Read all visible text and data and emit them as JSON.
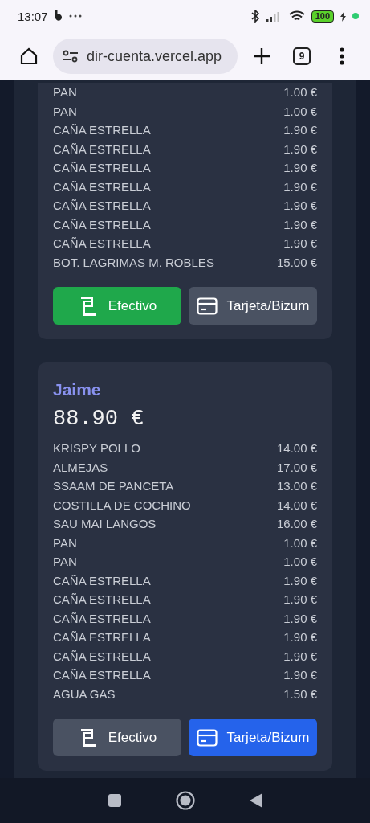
{
  "status_bar": {
    "time": "13:07",
    "battery": "100"
  },
  "browser": {
    "url": "dir-cuenta.vercel.app",
    "tab_count": "9"
  },
  "people": [
    {
      "items": [
        {
          "name": "PAN",
          "price": "1.00 €"
        },
        {
          "name": "PAN",
          "price": "1.00 €"
        },
        {
          "name": "CAÑA ESTRELLA",
          "price": "1.90 €"
        },
        {
          "name": "CAÑA ESTRELLA",
          "price": "1.90 €"
        },
        {
          "name": "CAÑA ESTRELLA",
          "price": "1.90 €"
        },
        {
          "name": "CAÑA ESTRELLA",
          "price": "1.90 €"
        },
        {
          "name": "CAÑA ESTRELLA",
          "price": "1.90 €"
        },
        {
          "name": "CAÑA ESTRELLA",
          "price": "1.90 €"
        },
        {
          "name": "CAÑA ESTRELLA",
          "price": "1.90 €"
        },
        {
          "name": "BOT. LAGRIMAS M. ROBLES",
          "price": "15.00 €"
        }
      ],
      "payment": [
        {
          "kind": "cash",
          "label": "Efectivo",
          "selected": true
        },
        {
          "kind": "card",
          "label": "Tarjeta/Bizum",
          "selected": false
        }
      ]
    },
    {
      "name": "Jaime",
      "total": "88.90 €",
      "items": [
        {
          "name": "KRISPY POLLO",
          "price": "14.00 €"
        },
        {
          "name": "ALMEJAS",
          "price": "17.00 €"
        },
        {
          "name": "SSAAM DE PANCETA",
          "price": "13.00 €"
        },
        {
          "name": "COSTILLA DE COCHINO",
          "price": "14.00 €"
        },
        {
          "name": "SAU MAI LANGOS",
          "price": "16.00 €"
        },
        {
          "name": "PAN",
          "price": "1.00 €"
        },
        {
          "name": "PAN",
          "price": "1.00 €"
        },
        {
          "name": "CAÑA ESTRELLA",
          "price": "1.90 €"
        },
        {
          "name": "CAÑA ESTRELLA",
          "price": "1.90 €"
        },
        {
          "name": "CAÑA ESTRELLA",
          "price": "1.90 €"
        },
        {
          "name": "CAÑA ESTRELLA",
          "price": "1.90 €"
        },
        {
          "name": "CAÑA ESTRELLA",
          "price": "1.90 €"
        },
        {
          "name": "CAÑA ESTRELLA",
          "price": "1.90 €"
        },
        {
          "name": "AGUA GAS",
          "price": "1.50 €"
        }
      ],
      "payment": [
        {
          "kind": "cash",
          "label": "Efectivo",
          "selected": false
        },
        {
          "kind": "card",
          "label": "Tarjeta/Bizum",
          "selected": true
        }
      ]
    }
  ]
}
